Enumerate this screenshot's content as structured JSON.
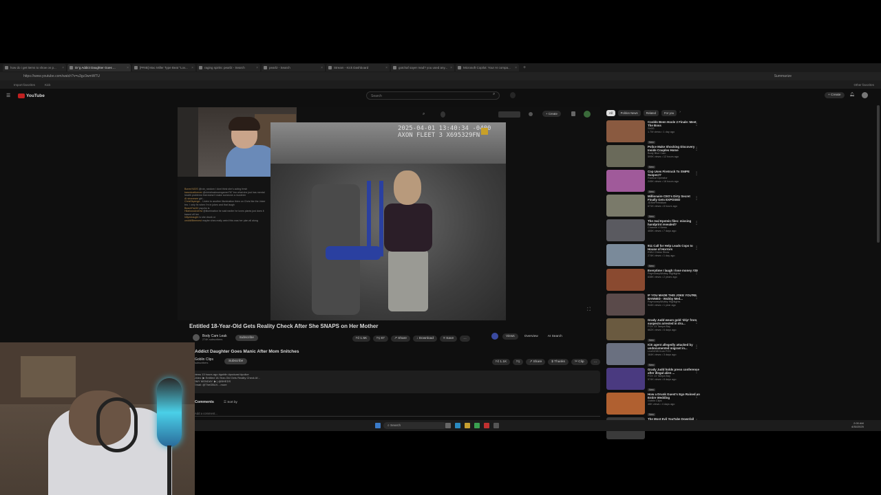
{
  "browser": {
    "tabs": [
      {
        "title": "how do i get items to show on p..."
      },
      {
        "title": "Dr’g Addict Daughter Goes ...",
        "active": true
      },
      {
        "title": "[PRIB] Mac Miller Type Beat \"Lov..."
      },
      {
        "title": "raging spirits: pearl2 - Search"
      },
      {
        "title": "pearl2 - Search"
      },
      {
        "title": "Stream - Kick Dashboard"
      },
      {
        "title": "gotchaf sayer read? you used any..."
      },
      {
        "title": "Microsoft Copilot: Your AI compa..."
      }
    ],
    "url": "https://www.youtube.com/watch?v=u3gz3wmWTU",
    "bookmarks": [
      "Import favorites",
      "Kick"
    ],
    "right_labels": [
      "Summarize",
      "Other favorites"
    ]
  },
  "youtube": {
    "logo_text": "YouTube",
    "search_placeholder": "Search",
    "create_label": "+ Create",
    "embedded": {
      "create_label": "+ Create",
      "timestamp_line1": "2025-04-01 13:40:34 -0400",
      "timestamp_line2": "AXON FLEET 3 X695329FN",
      "chat": [
        {
          "user": "Bones%20S",
          "msg": "@rob_random I dont think she's acting fresh"
        },
        {
          "user": "basedcatforever",
          "msg": "@christinabrowngamer767 bro what she just has mental health problems that doesn't make someone a murderer"
        },
        {
          "user": "AI stronesee",
          "msg": "girl..."
        },
        {
          "user": "ChrisSkyenge...",
          "msg": "Listen to another illumination thien on Chris like the Joker bro. I only fix when I'm in jokes and that laugh"
        },
        {
          "user": "BeachFan52",
          "msg": "psycho is"
        },
        {
          "user": "HilariousAndrew",
          "msg": "@illumination he said earlier he loves plants just does it based off her"
        },
        {
          "user": "hillyedraught",
          "msg": "is she drunk or"
        },
        {
          "user": "ceddit/Breenest",
          "msg": "maybe shes really weird this was her plan all along"
        }
      ],
      "title": "Entitled 18-Year-Old Gets Reality Check After She SNAPS on Her Mother",
      "channel": "Body Cam Leak",
      "subscribers": "274K subscribers",
      "subscribe_label": "Subscribe",
      "likes": "1.5K",
      "dislikes": "67",
      "share_label": "Share",
      "download_label": "Download",
      "save_label": "Save",
      "tabs": [
        "Views",
        "Overview",
        "AI Search"
      ]
    },
    "outer": {
      "title": "Addict Daughter Goes Manic After Mom Snitches",
      "channel": "Goblin Clips",
      "subscribers": "subscribers",
      "subscribe_label": "Subscribe",
      "likes": "1.1K",
      "share_label": "Share",
      "thanks_label": "Thanks",
      "clip_label": "Clip",
      "desc_line1": "views 13 hours ago #goblin #podcast #police",
      "desc_line2": "Video: ▶ Entitled 18-Year-Old Gets Reality Check Af...",
      "desc_line3": "SMY MONDAY: ▶ | @BHEDS",
      "desc_line4": "Email: @TheGBLN ...more",
      "comments_label": "Comments",
      "sort_label": "Sort by",
      "add_comment": "Add a comment..."
    },
    "chips": [
      "All",
      "Politics News",
      "Related",
      "For you"
    ],
    "recommendations": [
      {
        "title": "Coolds Been Hoole 2 Finale: Meet The Boss",
        "channel": "Sh0G",
        "meta": "1.7M views • 1 day ago",
        "new": "New",
        "color": "#8a5a40"
      },
      {
        "title": "Police Make Shocking Discovery Inside Couples Home",
        "channel": "Body Blue Cam",
        "meta": "599K views • 12 hours ago",
        "new": "New",
        "color": "#6a6a5a"
      },
      {
        "title": "Cop Uses Firetruck To SNIPE Suspect?",
        "channel": "Radical Operator",
        "meta": "245K views • 16 hours ago",
        "new": "New",
        "color": "#a05a9a"
      },
      {
        "title": "Millionaire CEO's Dirty Secret Finally Gets EXPOSED",
        "channel": "JDSinPerhidium",
        "meta": "671K views • 8 hours ago",
        "new": "New",
        "color": "#7a7a6a"
      },
      {
        "title": "The real Epstein files: missing handprint revealed?",
        "channel": "Channel 4 News",
        "meta": "465K views • 7 days ago",
        "new": "",
        "color": "#5a5a60"
      },
      {
        "title": "911 Call for Help Leads Cops to House of Horrors",
        "channel": "EWU Chess Show",
        "meta": "274K views • 1 day ago",
        "new": "New",
        "color": "#7a8a9a"
      },
      {
        "title": "Everytime I laugh I lose money #29",
        "channel": "PaymoneyWubby Highlights",
        "meta": "638K views • 2 years ago",
        "new": "",
        "color": "#8a4a30"
      },
      {
        "title": "IF YOU MADE THIS JOKE YOU'RE BANNED - Wubby Med...",
        "channel": "PaymoneyWubby Highlights",
        "meta": "944K views • 1 year ago",
        "new": "",
        "color": "#5a4a4a"
      },
      {
        "title": "Grady Judd wears gold 'drip' from suspects arrested in dru...",
        "channel": "FOX 13 Tampa Bay",
        "meta": "662K views • 6 days ago",
        "new": "New",
        "color": "#6a5a40"
      },
      {
        "title": "ICE agent allegedly attacked by undocumented migrant in...",
        "channel": "LiveNOW from FOX",
        "meta": "164K views • 3 days ago",
        "new": "New",
        "color": "#6a7080"
      },
      {
        "title": "Grady Judd holds press conference after illegal alien ...",
        "channel": "FOX 13 Tampa Bay",
        "meta": "574K views • 8 days ago",
        "new": "New",
        "color": "#4a3a80"
      },
      {
        "title": "How a Drunk Guest's Ego Ruined an Entire Wedding",
        "channel": "Goblin Clips",
        "meta": "46K views • 4 days ago",
        "new": "New",
        "color": "#b06030"
      },
      {
        "title": "The Most Evil YouTube Downfall",
        "channel": "",
        "meta": "",
        "new": "",
        "color": "#3a3a3a"
      }
    ]
  },
  "taskbar": {
    "search_label": "Search",
    "time": "2:00 AM",
    "date": "4/30/2025"
  }
}
